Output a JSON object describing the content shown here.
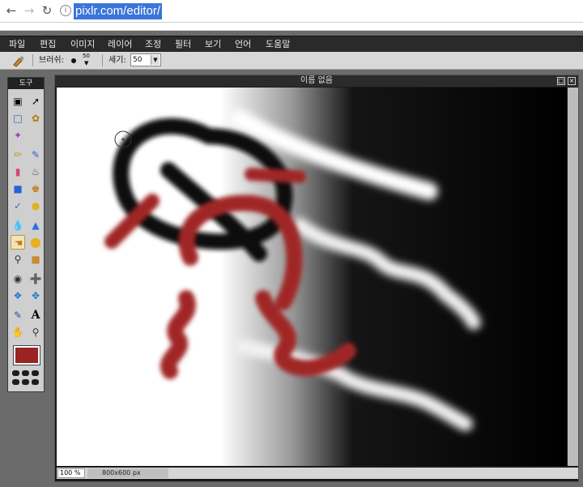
{
  "browser": {
    "url": "pixlr.com/editor/"
  },
  "menu": {
    "items": [
      "파일",
      "편집",
      "이미지",
      "레이어",
      "조정",
      "필터",
      "보기",
      "언어",
      "도움말"
    ]
  },
  "options": {
    "brush_label": "브러쉬:",
    "brush_size": "50",
    "opacity_label": "세기:",
    "opacity_value": "50"
  },
  "toolbox": {
    "title": "도구",
    "selected_color": "#9a2323"
  },
  "document": {
    "title": "이름 없음",
    "zoom": "100 %",
    "dimensions": "800x600 px"
  }
}
